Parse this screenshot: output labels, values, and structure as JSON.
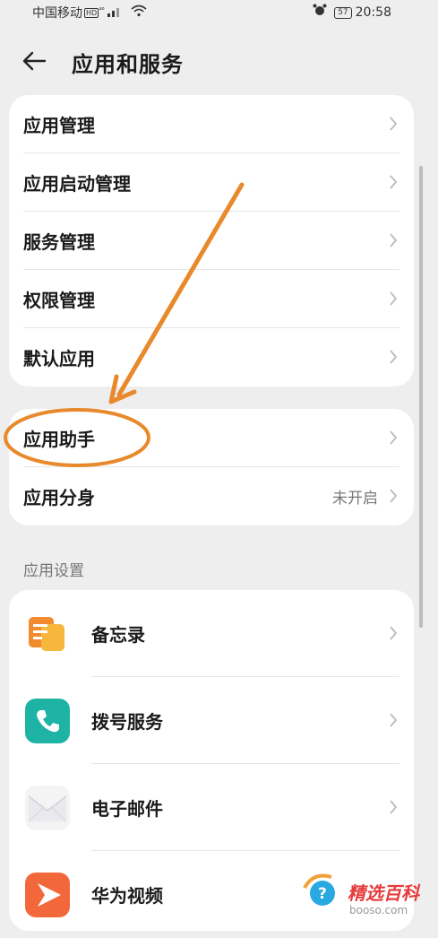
{
  "status": {
    "carrier": "中国移动",
    "hd": "HD",
    "net": "⁴⁶",
    "battery": "57",
    "time": "20:58"
  },
  "header": {
    "title": "应用和服务"
  },
  "card1": {
    "items": [
      {
        "label": "应用管理"
      },
      {
        "label": "应用启动管理"
      },
      {
        "label": "服务管理"
      },
      {
        "label": "权限管理"
      },
      {
        "label": "默认应用"
      }
    ]
  },
  "card2": {
    "items": [
      {
        "label": "应用助手",
        "value": ""
      },
      {
        "label": "应用分身",
        "value": "未开启"
      }
    ]
  },
  "section": {
    "label": "应用设置"
  },
  "apps": [
    {
      "label": "备忘录",
      "icon": "notes-icon",
      "color": "#f28a2e"
    },
    {
      "label": "拨号服务",
      "icon": "phone-icon",
      "color": "#1fb3a6"
    },
    {
      "label": "电子邮件",
      "icon": "mail-icon",
      "color": "#f4f4f4"
    },
    {
      "label": "华为视频",
      "icon": "video-icon",
      "color": "#f2683a"
    }
  ],
  "watermark": {
    "brand": "精选百科",
    "site": "booso.com"
  },
  "colors": {
    "annotation": "#e8892b",
    "background": "#eeeeee"
  }
}
